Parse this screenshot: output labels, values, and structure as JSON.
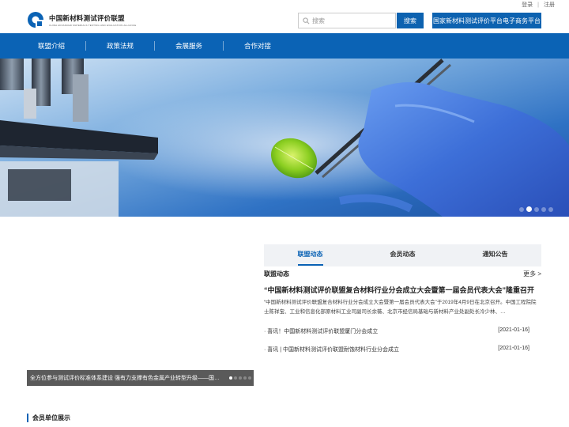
{
  "top_links": {
    "login": "登录",
    "separator": "|",
    "register": "注册"
  },
  "logo": {
    "name_cn": "中国新材料测试评价联盟",
    "name_en": "CHINA ADVANCED MATERIALS TESTING AND EVALUATION ALLIANCE"
  },
  "search": {
    "placeholder": "搜索",
    "button_label": "搜索"
  },
  "platform_button": "国家新材料测试评价平台电子商务平台",
  "nav": {
    "items": [
      "联盟介绍",
      "政策法规",
      "会展服务",
      "合作对接"
    ]
  },
  "banner": {
    "slide_count": 5,
    "active_slide": 2
  },
  "slider": {
    "caption": "全方位参与测试评价标准体系建设 强有力支撑有色金属产业转型升级——国…",
    "dot_count": 5,
    "active_dot": 1
  },
  "news_tabs": {
    "items": [
      "联盟动态",
      "会员动态",
      "通知公告"
    ],
    "active": 0
  },
  "news_section": {
    "title": "联盟动态",
    "more": "更多 >",
    "headline": "“中国新材料测试评价联盟复合材料行业分会成立大会暨第一届会员代表大会”隆重召开",
    "summary": "“中国新材料测试评价联盟复合材料行业分会成立大会暨第一届会员代表大会”于2019年4月9日在北京召开。中国工程院院士陈祥宝、工业和信息化部原材料工业司副司长余薇、北京市经信局基础与新材料产业处副处长冷少林、…",
    "items": [
      {
        "title": "喜讯！中国新材料测试评价联盟厦门分会成立",
        "date": "[2021-01-16]"
      },
      {
        "title": "喜讯 | 中国新材料测试评价联盟耐蚀材料行业分会成立",
        "date": "[2021-01-16]"
      }
    ]
  },
  "members_title": "会员单位展示",
  "colors": {
    "brand_blue": "#0b63b5",
    "button_blue": "#0d62b0",
    "tab_bg": "#f0f2f5"
  }
}
